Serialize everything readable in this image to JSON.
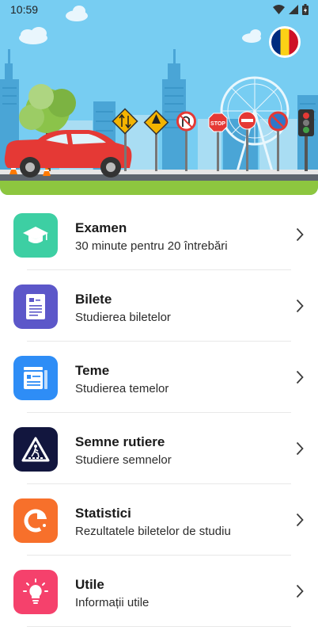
{
  "status": {
    "time": "10:59"
  },
  "banner": {
    "flag": "romania-flag-icon",
    "colors": {
      "sky": "#77cdf2",
      "road": "#5e666e",
      "grass": "#8dc63f",
      "car": "#e53935"
    }
  },
  "menu": {
    "items": [
      {
        "title": "Examen",
        "subtitle": "30 minute pentru 20 întrebări",
        "icon": "graduation-cap-icon",
        "color": "#3dcfa3"
      },
      {
        "title": "Bilete",
        "subtitle": "Studierea biletelor",
        "icon": "ticket-icon",
        "color": "#5c57c9"
      },
      {
        "title": "Teme",
        "subtitle": "Studierea temelor",
        "icon": "topics-icon",
        "color": "#2e8df6"
      },
      {
        "title": "Semne rutiere",
        "subtitle": "Studiere semnelor",
        "icon": "pedestrian-crossing-icon",
        "color": "#12163e"
      },
      {
        "title": "Statistici",
        "subtitle": "Rezultatele biletelor de studiu",
        "icon": "pie-chart-icon",
        "color": "#f7702b"
      },
      {
        "title": "Utile",
        "subtitle": "Informații utile",
        "icon": "lightbulb-icon",
        "color": "#f5416c"
      }
    ]
  }
}
